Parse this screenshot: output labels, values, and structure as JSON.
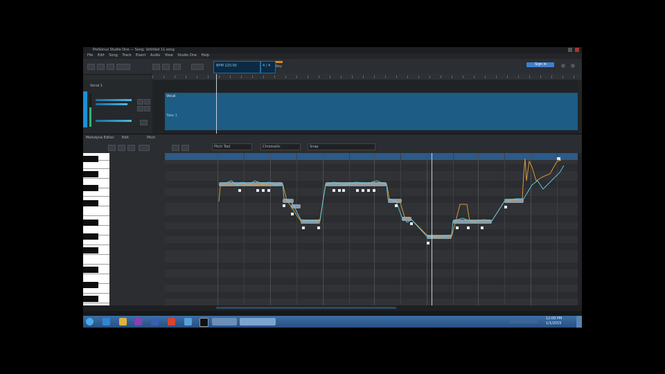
{
  "window": {
    "title": "PreSonus Studio One — Song: Untitled 11.song"
  },
  "menu": [
    "File",
    "Edit",
    "Song",
    "Track",
    "Event",
    "Audio",
    "View",
    "Studio One",
    "Help"
  ],
  "toolbar": {
    "tempo_label": "BPM 120.00",
    "timesig_label": "4 / 4",
    "key_label": "Key",
    "signin_label": "Sign in"
  },
  "track": {
    "name": "Vocal 1",
    "clip_label": "Vocal",
    "clip_sub": "Take 1"
  },
  "editor": {
    "tab_label": "Melodyne Editor",
    "tab2": "Edit",
    "tab3": "Pitch",
    "mode_label": "Pitch Tool",
    "scale_label": "Chromatic",
    "snap_label": "Snap"
  },
  "taskbar": {
    "time": "12:00 PM",
    "date": "1/1/2015"
  },
  "colors": {
    "accent": "#1d5c84",
    "note_blob": "#8d9aa6",
    "pitch_curve": "#5cc6e6",
    "original_curve": "#d99a3c",
    "playhead": "#c9d3dc"
  }
}
